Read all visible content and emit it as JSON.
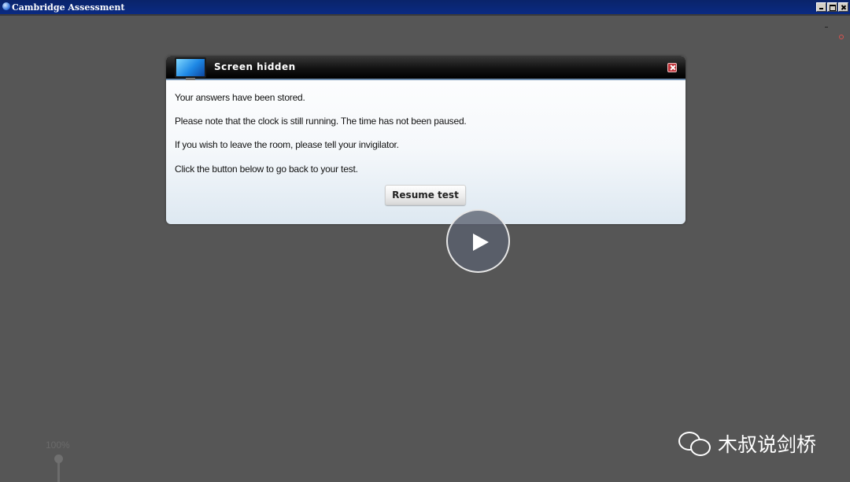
{
  "window": {
    "title": "Cambridge Assessment",
    "icon": "globe-icon",
    "controls": [
      "minimize-icon",
      "maximize-icon",
      "close-icon"
    ]
  },
  "dialog": {
    "title": "Screen hidden",
    "icon": "monitor-icon",
    "close_icon": "close-icon",
    "messages": [
      "Your answers have been stored.",
      "Please note that the clock is still running. The time has not been paused.",
      "If you wish to leave the room, please tell your invigilator.",
      "Click the button below to go back to your test."
    ],
    "button_label": "Resume test"
  },
  "video": {
    "play_icon": "play-icon"
  },
  "zoom": {
    "label": "100%"
  },
  "watermark": {
    "icon": "wechat-icon",
    "text": "木叔说剑桥"
  },
  "colors": {
    "background": "#565656",
    "titlebar": "#0a246a",
    "dialog_header": "#121212",
    "close_red": "#c0353b"
  }
}
